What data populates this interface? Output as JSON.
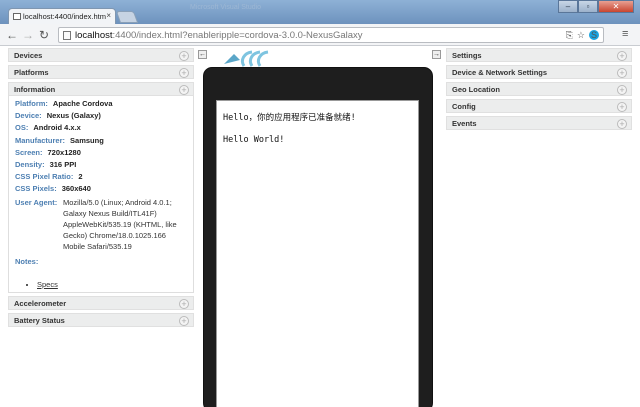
{
  "browser": {
    "tab_title": "localhost:4400/index.htm",
    "tab_close": "×",
    "window_title": "Microsoft Visual Studio",
    "url_host": "localhost",
    "url_rest": ":4400/index.html?enableripple=cordova-3.0.0-NexusGalaxy",
    "nav_back": "←",
    "nav_forward": "→",
    "nav_reload": "↻",
    "menu": "≡"
  },
  "left_panel": {
    "sections": {
      "devices": "Devices",
      "platforms": "Platforms",
      "information": "Information",
      "accelerometer": "Accelerometer",
      "battery": "Battery Status"
    },
    "info": {
      "platform_label": "Platform:",
      "platform_value": "Apache Cordova",
      "device_label": "Device:",
      "device_value": "Nexus (Galaxy)",
      "os_label": "OS:",
      "os_value": "Android 4.x.x",
      "manufacturer_label": "Manufacturer:",
      "manufacturer_value": "Samsung",
      "screen_label": "Screen:",
      "screen_value": "720x1280",
      "density_label": "Density:",
      "density_value": "316 PPI",
      "ratio_label": "CSS Pixel Ratio:",
      "ratio_value": "2",
      "csspixels_label": "CSS Pixels:",
      "csspixels_value": "360x640",
      "ua_label": "User Agent:",
      "ua_value": "Mozilla/5.0 (Linux; Android 4.0.1; Galaxy Nexus Build/ITL41F) AppleWebKit/535.19 (KHTML, like Gecko) Chrome/18.0.1025.166 Mobile Safari/535.19",
      "notes_label": "Notes:",
      "specs_link": "Specs"
    }
  },
  "right_panel": {
    "settings": "Settings",
    "device_network": "Device & Network Settings",
    "geo": "Geo Location",
    "config": "Config",
    "events": "Events"
  },
  "device_screen": {
    "line1": "Hello，你的应用程序已准备就绪!",
    "line2": "Hello World!"
  },
  "plus_glyph": "+",
  "colors": {
    "label_blue": "#4d7fb2",
    "header_bg": "#eceded",
    "phone": "#1e1e1e"
  }
}
